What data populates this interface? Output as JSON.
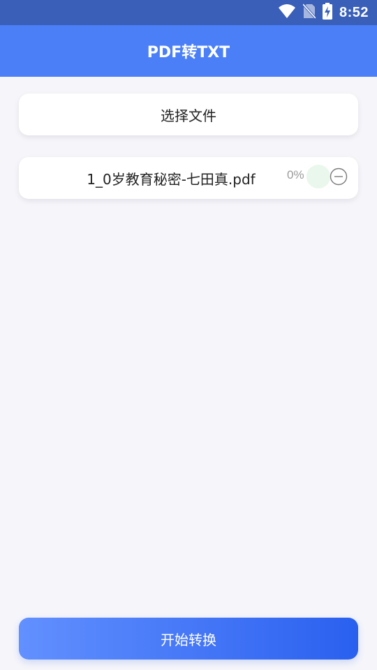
{
  "status_bar": {
    "time": "8:52",
    "icons": [
      "wifi-icon",
      "no-sim-icon",
      "battery-charging-icon"
    ]
  },
  "app_bar": {
    "title": "PDF转TXT"
  },
  "select_file": {
    "label": "选择文件"
  },
  "file_item": {
    "name": "1_0岁教育秘密-七田真.pdf",
    "progress_text": "0%",
    "progress": 0,
    "remove_icon": "minus-circle-icon"
  },
  "start_button": {
    "label": "开始转换"
  },
  "colors": {
    "status_bar": "#3a5fb8",
    "app_bar": "#4a7ff7",
    "background": "#f5f5fa",
    "button_gradient_start": "#6290ff",
    "button_gradient_end": "#2a60ef"
  }
}
